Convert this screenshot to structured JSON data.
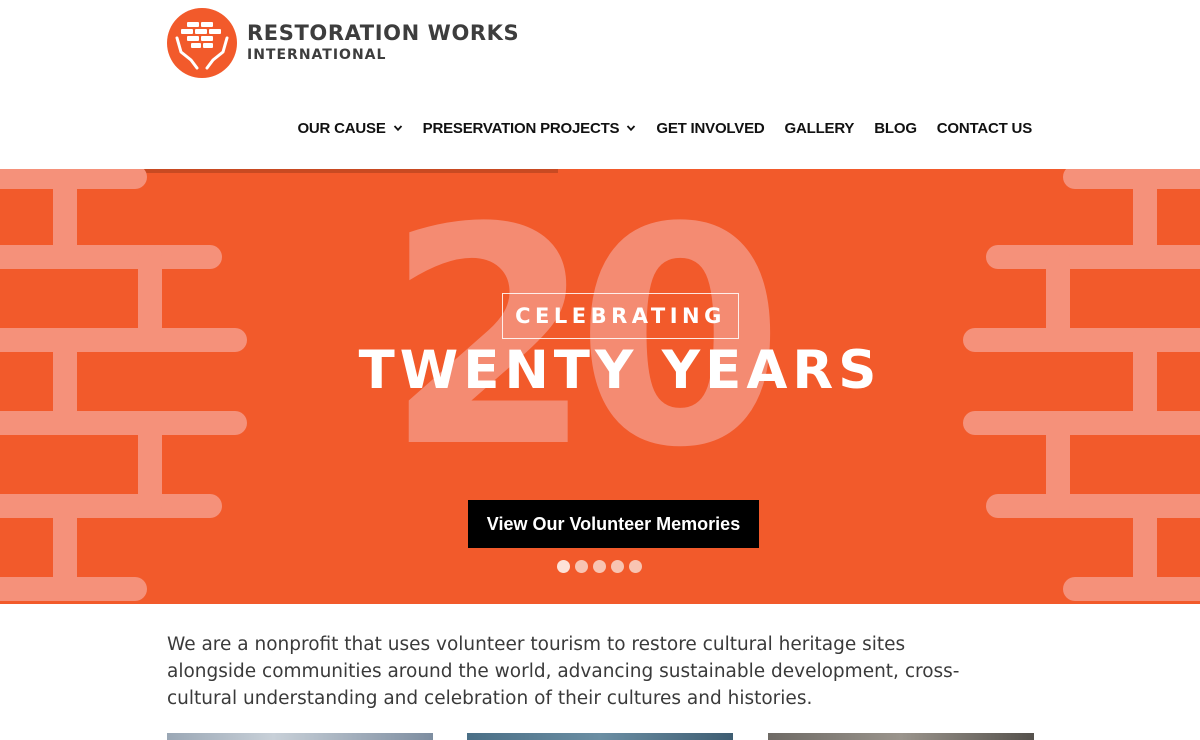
{
  "brand": {
    "line1": "RESTORATION WORKS",
    "line2": "INTERNATIONAL",
    "color": "#f25a2b"
  },
  "nav": {
    "items": [
      {
        "label": "OUR CAUSE",
        "has_dropdown": true
      },
      {
        "label": "PRESERVATION PROJECTS",
        "has_dropdown": true
      },
      {
        "label": "GET INVOLVED",
        "has_dropdown": false
      },
      {
        "label": "GALLERY",
        "has_dropdown": false
      },
      {
        "label": "BLOG",
        "has_dropdown": false
      },
      {
        "label": "CONTACT US",
        "has_dropdown": false
      }
    ]
  },
  "hero": {
    "big_number": "20",
    "badge_text": "CELEBRATING",
    "headline": "TWENTY YEARS",
    "cta_label": "View Our Volunteer Memories",
    "slide_count": 5,
    "active_slide": 1,
    "background_color": "#f25a2b"
  },
  "intro": {
    "text": "We are a nonprofit that uses volunteer tourism to restore cultural heritage sites alongside communities around the world, advancing sustainable development, cross-cultural understanding and celebration of their cultures and histories."
  },
  "thumbnails": [
    {
      "icon": "project-photo-1"
    },
    {
      "icon": "project-photo-2"
    },
    {
      "icon": "project-photo-3"
    }
  ]
}
